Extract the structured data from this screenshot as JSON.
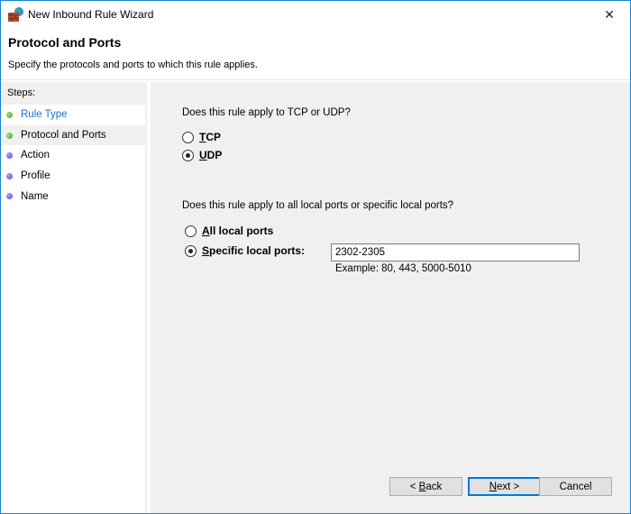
{
  "window": {
    "title": "New Inbound Rule Wizard",
    "close_label": "✕"
  },
  "header": {
    "title": "Protocol and Ports",
    "subtitle": "Specify the protocols and ports to which this rule applies."
  },
  "sidebar": {
    "heading": "Steps:",
    "items": [
      {
        "label": "Rule Type",
        "status": "completed",
        "dot_color": "#3aa81c",
        "is_link": true,
        "active": false
      },
      {
        "label": "Protocol and Ports",
        "status": "current",
        "dot_color": "#3aa81c",
        "is_link": false,
        "active": true
      },
      {
        "label": "Action",
        "status": "pending",
        "dot_color": "#4848c8",
        "is_link": false,
        "active": false
      },
      {
        "label": "Profile",
        "status": "pending",
        "dot_color": "#4848c8",
        "is_link": false,
        "active": false
      },
      {
        "label": "Name",
        "status": "pending",
        "dot_color": "#4848c8",
        "is_link": false,
        "active": false
      }
    ]
  },
  "protocol": {
    "question": "Does this rule apply to TCP or UDP?",
    "options": [
      {
        "label_accel": "T",
        "label_rest": "CP",
        "selected": false
      },
      {
        "label_accel": "U",
        "label_rest": "DP",
        "selected": true
      }
    ]
  },
  "ports": {
    "question": "Does this rule apply to all local ports or specific local ports?",
    "options": [
      {
        "label_accel": "A",
        "label_rest": "ll local ports",
        "selected": false
      },
      {
        "label_accel": "S",
        "label_rest": "pecific local ports:",
        "selected": true
      }
    ],
    "input_value": "2302-2305",
    "example": "Example: 80, 443, 5000-5010"
  },
  "buttons": {
    "back_prefix": "< ",
    "back_accel": "B",
    "back_rest": "ack",
    "next_accel": "N",
    "next_rest": "ext >",
    "cancel": "Cancel"
  },
  "colors": {
    "window_border": "#1883d7",
    "link": "#1a6fce",
    "content_bg": "#f0f0f0",
    "default_button_border": "#0078d7"
  }
}
